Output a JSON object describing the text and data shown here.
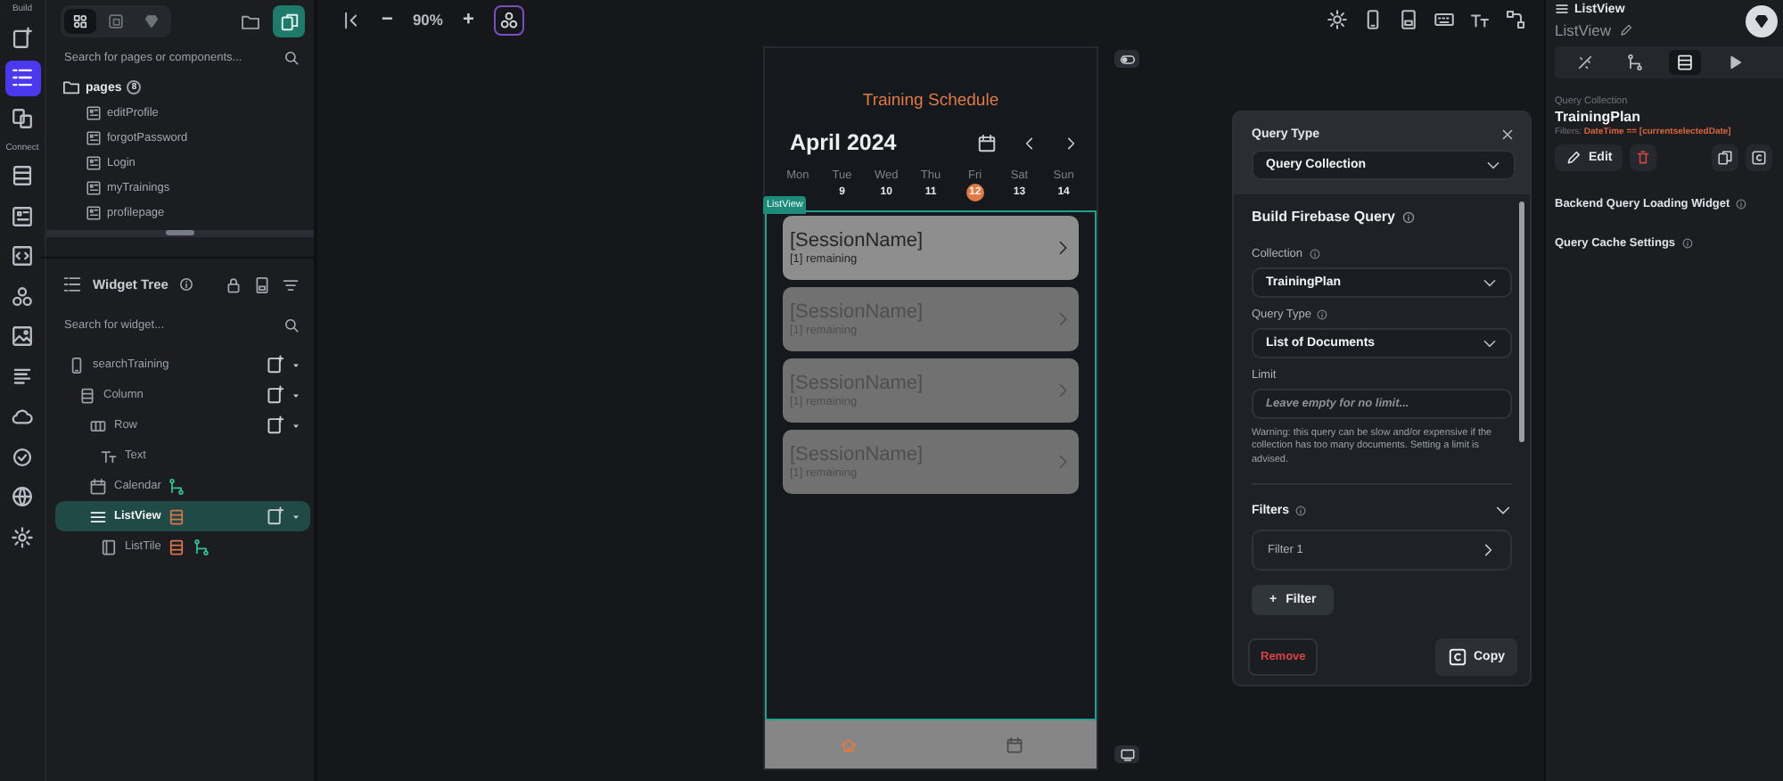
{
  "rail": {
    "build_label": "Build",
    "connect_label": "Connect",
    "build_items": [
      {
        "selected": false
      },
      {
        "selected": true
      },
      {
        "selected": false
      }
    ],
    "connect_items": [
      {
        "selected": false
      },
      {
        "selected": false
      },
      {
        "selected": false
      },
      {
        "selected": false
      },
      {
        "selected": false
      },
      {
        "selected": false
      },
      {
        "selected": false
      },
      {
        "selected": false
      },
      {
        "selected": false
      },
      {
        "selected": false
      }
    ]
  },
  "left_panel": {
    "mode_tabs": [
      {
        "selected": true
      },
      {
        "selected": false
      },
      {
        "selected": false
      }
    ],
    "search_placeholder": "Search for pages or components...",
    "pages": {
      "label": "pages",
      "count": "8",
      "items": [
        "editProfile",
        "forgotPassword",
        "Login",
        "myTrainings",
        "profilepage"
      ]
    },
    "widget_tree": {
      "title": "Widget Tree",
      "search_placeholder": "Search for widget...",
      "nodes": [
        {
          "label": "searchTraining",
          "kind": "page",
          "selected": false,
          "query": false,
          "actions": false,
          "children": [
            {
              "label": "Column",
              "kind": "column",
              "selected": false,
              "query": false,
              "actions": false,
              "children": [
                {
                  "label": "Row",
                  "kind": "row",
                  "selected": false,
                  "query": false,
                  "actions": false,
                  "children": [
                    {
                      "label": "Text",
                      "kind": "text",
                      "selected": false,
                      "query": false,
                      "actions": false
                    }
                  ]
                },
                {
                  "label": "Calendar",
                  "kind": "calendar",
                  "selected": false,
                  "query": false,
                  "actions": true
                },
                {
                  "label": "ListView",
                  "kind": "listview",
                  "selected": true,
                  "query": true,
                  "actions": false,
                  "children": [
                    {
                      "label": "ListTile",
                      "kind": "listtile",
                      "selected": false,
                      "query": true,
                      "actions": true
                    }
                  ]
                }
              ]
            }
          ]
        }
      ]
    }
  },
  "canvas": {
    "zoom_out": "−",
    "zoom": "90%",
    "zoom_in": "+"
  },
  "phone": {
    "title": "Training Schedule",
    "month": "April 2024",
    "days": [
      {
        "label": "Mon",
        "selected": false
      },
      {
        "label": "Tue",
        "number": "9",
        "selected": false
      },
      {
        "label": "Wed",
        "number": "10",
        "selected": false
      },
      {
        "label": "Thu",
        "number": "11",
        "selected": false
      },
      {
        "label": "Fri",
        "number": "12",
        "selected": true
      },
      {
        "label": "Sat",
        "number": "13",
        "selected": false
      },
      {
        "label": "Sun",
        "number": "14",
        "selected": false
      }
    ],
    "badge": "ListView",
    "cards": [
      {
        "title": "[SessionName]",
        "subtitle": "[1] remaining",
        "dimmed": false
      },
      {
        "title": "[SessionName]",
        "subtitle": "[1] remaining",
        "dimmed": true
      },
      {
        "title": "[SessionName]",
        "subtitle": "[1] remaining",
        "dimmed": true
      },
      {
        "title": "[SessionName]",
        "subtitle": "[1] remaining",
        "dimmed": true
      }
    ],
    "nav": [
      {
        "selected": true
      },
      {
        "selected": false
      }
    ]
  },
  "query_panel": {
    "title": "Query Type",
    "query_type": "Query Collection",
    "section_title": "Build Firebase Query",
    "collection_label": "Collection",
    "collection": "TrainingPlan",
    "type_label": "Query Type",
    "type": "List of Documents",
    "limit_label": "Limit",
    "limit_placeholder": "Leave empty for no limit...",
    "warning": "Warning: this query can be slow and/or expensive if the collection has too many documents. Setting a limit is advised.",
    "filters_label": "Filters",
    "filters": [
      "Filter 1"
    ],
    "add_filter_icon": "+",
    "add_filter": "Filter",
    "remove": "Remove",
    "copy": "Copy"
  },
  "props": {
    "title": "ListView",
    "name": "ListView",
    "tabs": [
      {
        "selected": false
      },
      {
        "selected": false
      },
      {
        "selected": true
      },
      {
        "selected": false
      }
    ],
    "caption": "Query Collection",
    "collection": "TrainingPlan",
    "filters_label": "Filters:",
    "filter_expr": "DateTime == [currentselectedDate]",
    "edit": "Edit",
    "sections": [
      "Backend Query Loading Widget",
      "Query Cache Settings"
    ]
  }
}
